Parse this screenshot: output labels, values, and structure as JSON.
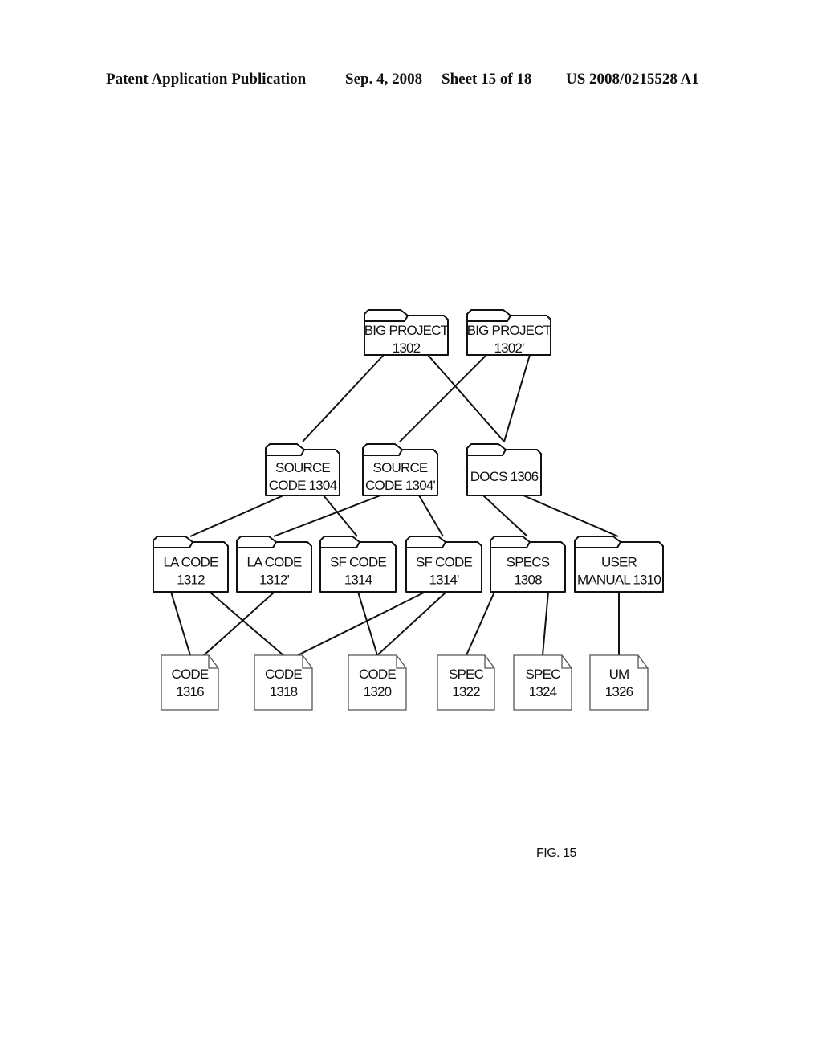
{
  "header": {
    "publication": "Patent Application Publication",
    "date": "Sep. 4, 2008",
    "sheet": "Sheet 15 of 18",
    "number": "US 2008/0215528 A1"
  },
  "figure": {
    "label": "FIG. 15",
    "nodes": [
      {
        "id": "1302",
        "type": "folder",
        "lines": [
          "BIG PROJECT",
          "1302"
        ]
      },
      {
        "id": "1302p",
        "type": "folder",
        "lines": [
          "BIG PROJECT",
          "1302'"
        ]
      },
      {
        "id": "1304",
        "type": "folder",
        "lines": [
          "SOURCE",
          "CODE 1304"
        ]
      },
      {
        "id": "1304p",
        "type": "folder",
        "lines": [
          "SOURCE",
          "CODE 1304'"
        ]
      },
      {
        "id": "1306",
        "type": "folder",
        "lines": [
          "DOCS 1306"
        ]
      },
      {
        "id": "1312",
        "type": "folder",
        "lines": [
          "LA CODE",
          "1312"
        ]
      },
      {
        "id": "1312p",
        "type": "folder",
        "lines": [
          "LA CODE",
          "1312'"
        ]
      },
      {
        "id": "1314",
        "type": "folder",
        "lines": [
          "SF CODE",
          "1314"
        ]
      },
      {
        "id": "1314p",
        "type": "folder",
        "lines": [
          "SF CODE",
          "1314'"
        ]
      },
      {
        "id": "1308",
        "type": "folder",
        "lines": [
          "SPECS",
          "1308"
        ]
      },
      {
        "id": "1310",
        "type": "folder",
        "lines": [
          "USER",
          "MANUAL 1310"
        ]
      },
      {
        "id": "1316",
        "type": "document",
        "lines": [
          "CODE",
          "1316"
        ]
      },
      {
        "id": "1318",
        "type": "document",
        "lines": [
          "CODE",
          "1318"
        ]
      },
      {
        "id": "1320",
        "type": "document",
        "lines": [
          "CODE",
          "1320"
        ]
      },
      {
        "id": "1322",
        "type": "document",
        "lines": [
          "SPEC",
          "1322"
        ]
      },
      {
        "id": "1324",
        "type": "document",
        "lines": [
          "SPEC",
          "1324"
        ]
      },
      {
        "id": "1326",
        "type": "document",
        "lines": [
          "UM",
          "1326"
        ]
      }
    ],
    "edges": [
      [
        "1302",
        "1304"
      ],
      [
        "1302",
        "1306"
      ],
      [
        "1302p",
        "1304p"
      ],
      [
        "1302p",
        "1306"
      ],
      [
        "1304",
        "1312"
      ],
      [
        "1304",
        "1314"
      ],
      [
        "1304p",
        "1312p"
      ],
      [
        "1304p",
        "1314p"
      ],
      [
        "1306",
        "1308"
      ],
      [
        "1306",
        "1310"
      ],
      [
        "1312",
        "1316"
      ],
      [
        "1312",
        "1318"
      ],
      [
        "1312p",
        "1316"
      ],
      [
        "1314",
        "1320"
      ],
      [
        "1314p",
        "1318"
      ],
      [
        "1314p",
        "1320"
      ],
      [
        "1308",
        "1322"
      ],
      [
        "1308",
        "1324"
      ],
      [
        "1310",
        "1326"
      ]
    ]
  }
}
